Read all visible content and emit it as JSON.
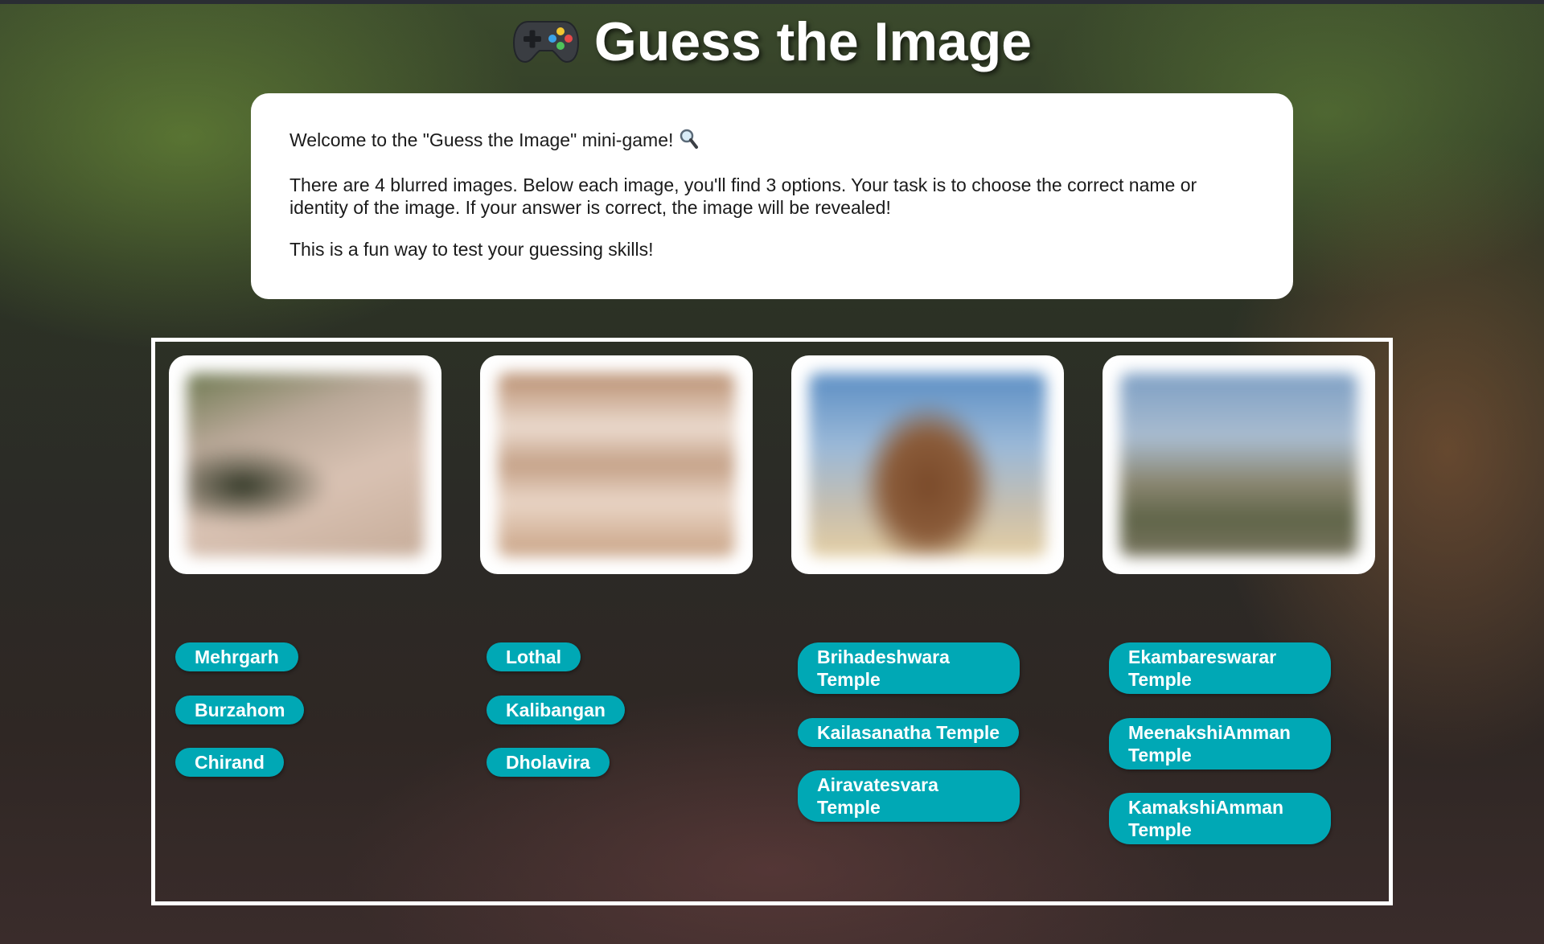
{
  "page": {
    "title": "Guess the Image",
    "title_icon": "game-controller-icon"
  },
  "intro": {
    "welcome": "Welcome to the \"Guess the Image\" mini-game!",
    "welcome_icon": "magnifying-glass-icon",
    "instructions": "There are 4 blurred images. Below each image, you'll find 3 options. Your task is to choose the correct name or identity of the image. If your answer is correct, the image will be revealed!",
    "tagline": "This is a fun way to test your guessing skills!"
  },
  "colors": {
    "option_button": "#00a8b5",
    "card_background": "#ffffff",
    "frame_border": "#ffffff"
  },
  "cards": [
    {
      "image_state": "blurred",
      "options": [
        "Mehrgarh",
        "Burzahom",
        "Chirand"
      ]
    },
    {
      "image_state": "blurred",
      "options": [
        "Lothal",
        "Kalibangan",
        "Dholavira"
      ]
    },
    {
      "image_state": "blurred",
      "options": [
        "Brihadeshwara Temple",
        "Kailasanatha Temple",
        "Airavatesvara Temple"
      ]
    },
    {
      "image_state": "blurred",
      "options": [
        "Ekambareswarar Temple",
        "MeenakshiAmman Temple",
        "KamakshiAmman Temple"
      ]
    }
  ]
}
